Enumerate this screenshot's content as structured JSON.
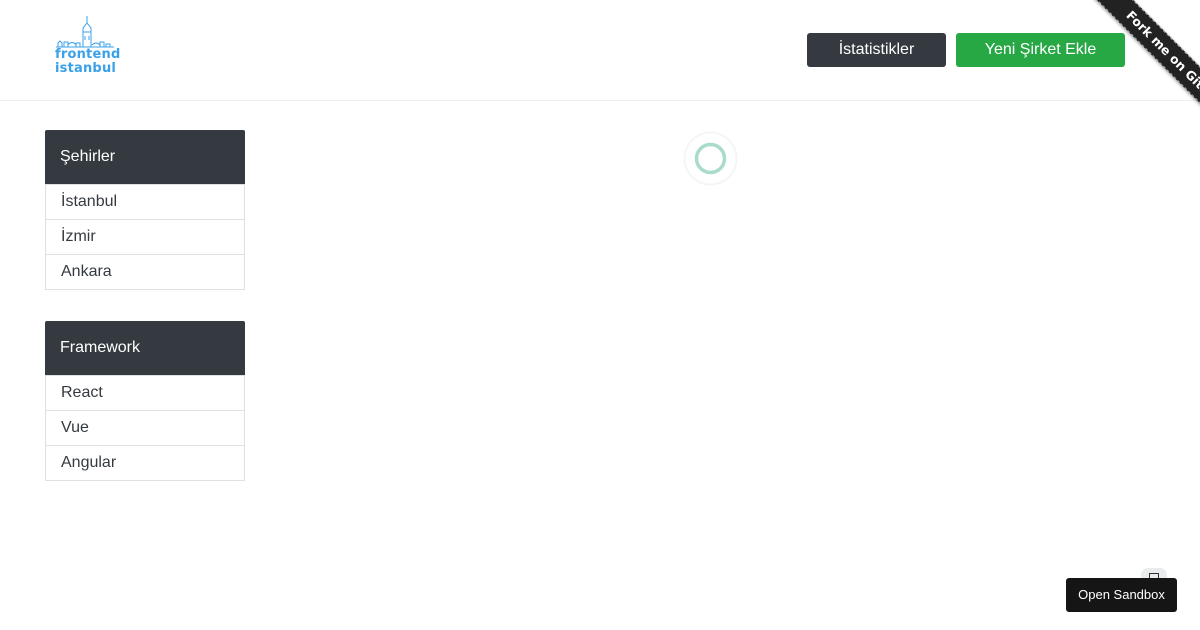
{
  "header": {
    "logo": {
      "line1": "frontend",
      "line2": "istanbul",
      "icon": "galata-tower-skyline-icon",
      "color": "#3aa0e8"
    },
    "stats_label": "İstatistikler",
    "new_company_label": "Yeni Şirket Ekle"
  },
  "ribbon": {
    "label": "Fork me on GitHub"
  },
  "sidebar": {
    "cities": {
      "title": "Şehirler",
      "items": [
        {
          "label": "İstanbul"
        },
        {
          "label": "İzmir"
        },
        {
          "label": "Ankara"
        }
      ]
    },
    "frameworks": {
      "title": "Framework",
      "items": [
        {
          "label": "React"
        },
        {
          "label": "Vue"
        },
        {
          "label": "Angular"
        }
      ]
    }
  },
  "main": {
    "loading_icon": "loading-spinner-icon",
    "spinner_color": "#a8dcc8"
  },
  "sandbox": {
    "label": "Open Sandbox",
    "icon": "sandbox-icon"
  },
  "colors": {
    "dark": "#343a40",
    "success": "#28a745"
  }
}
